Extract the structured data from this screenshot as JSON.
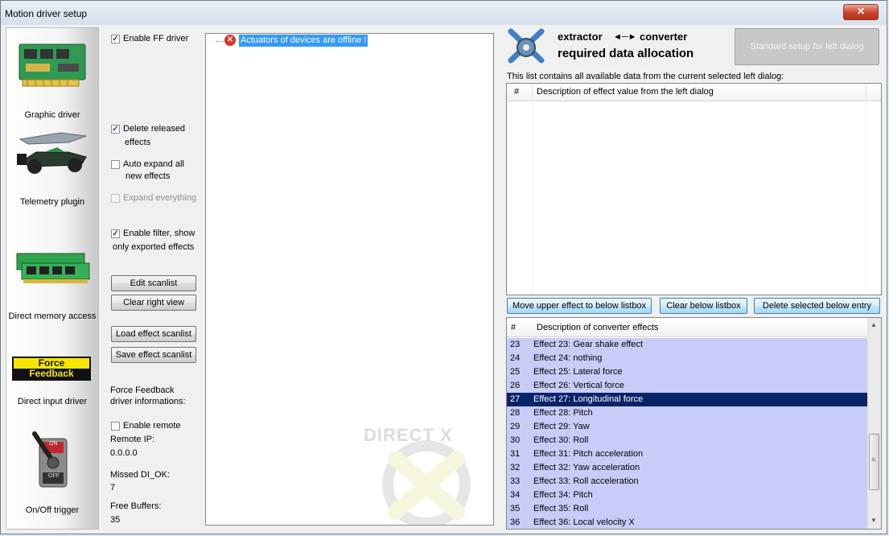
{
  "window": {
    "title": "Motion driver setup",
    "close_label": "✕"
  },
  "sidebar": {
    "items": [
      {
        "label": "Graphic driver",
        "icon": "graphics-card-icon"
      },
      {
        "label": "Telemetry plugin",
        "icon": "race-car-icon"
      },
      {
        "label": "Direct memory access",
        "icon": "memory-module-icon"
      },
      {
        "label": "Direct input driver",
        "icon": "force-feedback-icon",
        "badge_line1": "Force",
        "badge_line2": "Feedback"
      },
      {
        "label": "On/Off trigger",
        "icon": "toggle-switch-icon",
        "switch_on": "ON",
        "switch_off": "OFF"
      }
    ]
  },
  "options": {
    "enable_ff": {
      "label": "Enable FF driver",
      "checked": true
    },
    "delete_released": {
      "line1": "Delete released",
      "line2": "effects",
      "checked": true
    },
    "auto_expand": {
      "line1": "Auto expand all",
      "line2": "new effects",
      "checked": false
    },
    "expand_everything": {
      "label": "Expand everything",
      "checked": false,
      "disabled": true
    },
    "enable_filter": {
      "line1": "Enable filter, show",
      "line2": "only exported effects",
      "checked": true
    }
  },
  "buttons": {
    "edit_scanlist": "Edit scanlist",
    "clear_right_view": "Clear right view",
    "load_effect_scanlist": "Load effect scanlist",
    "save_effect_scanlist": "Save effect scanlist"
  },
  "driver_info": {
    "heading_line1": "Force Feedback",
    "heading_line2": "driver informations:",
    "enable_remote": {
      "label": "Enable remote",
      "checked": false
    },
    "remote_ip_label": "Remote IP:",
    "remote_ip": "0.0.0.0",
    "missed_label": "Missed DI_OK:",
    "missed_value": "7",
    "free_buffers_label": "Free Buffers:",
    "free_buffers_value": "35"
  },
  "tree": {
    "items": [
      {
        "text": "Actuators of devices are offline !",
        "status": "error-icon"
      }
    ],
    "watermark": "DIRECT X"
  },
  "allocation": {
    "title_left": "extractor",
    "title_arrow": "◄─►",
    "title_right": "converter",
    "subtitle": "required data allocation",
    "standard_setup_button": "Standard setup for left dialog",
    "list_caption": "This list contains all available data from the current selected left dialog:",
    "upper_list": {
      "col_num": "#",
      "col_desc": "Description of effect value from the left dialog"
    },
    "buttons": {
      "move_upper": "Move upper effect to below listbox",
      "clear_below": "Clear below listbox",
      "delete_selected": "Delete selected below entry"
    },
    "lower_list": {
      "col_num": "#",
      "col_desc": "Description of converter effects",
      "rows": [
        {
          "num": "23",
          "desc": "Effect 23: Gear shake effect"
        },
        {
          "num": "24",
          "desc": "Effect 24: nothing"
        },
        {
          "num": "25",
          "desc": "Effect 25: Lateral force"
        },
        {
          "num": "26",
          "desc": "Effect 26: Vertical force"
        },
        {
          "num": "27",
          "desc": "Effect 27: Longitudinal force",
          "selected": true
        },
        {
          "num": "28",
          "desc": "Effect 28: Pitch"
        },
        {
          "num": "29",
          "desc": "Effect 29: Yaw"
        },
        {
          "num": "30",
          "desc": "Effect 30: Roll"
        },
        {
          "num": "31",
          "desc": "Effect 31: Pitch acceleration"
        },
        {
          "num": "32",
          "desc": "Effect 32: Yaw acceleration"
        },
        {
          "num": "33",
          "desc": "Effect 33: Roll acceleration"
        },
        {
          "num": "34",
          "desc": "Effect 34: Pitch"
        },
        {
          "num": "35",
          "desc": "Effect 35: Roll"
        },
        {
          "num": "36",
          "desc": "Effect 36: Local velocity X"
        }
      ]
    }
  },
  "colors": {
    "selection": "#0a246a",
    "row_bg": "#c8cdf8",
    "tree_highlight": "#3399ff"
  }
}
